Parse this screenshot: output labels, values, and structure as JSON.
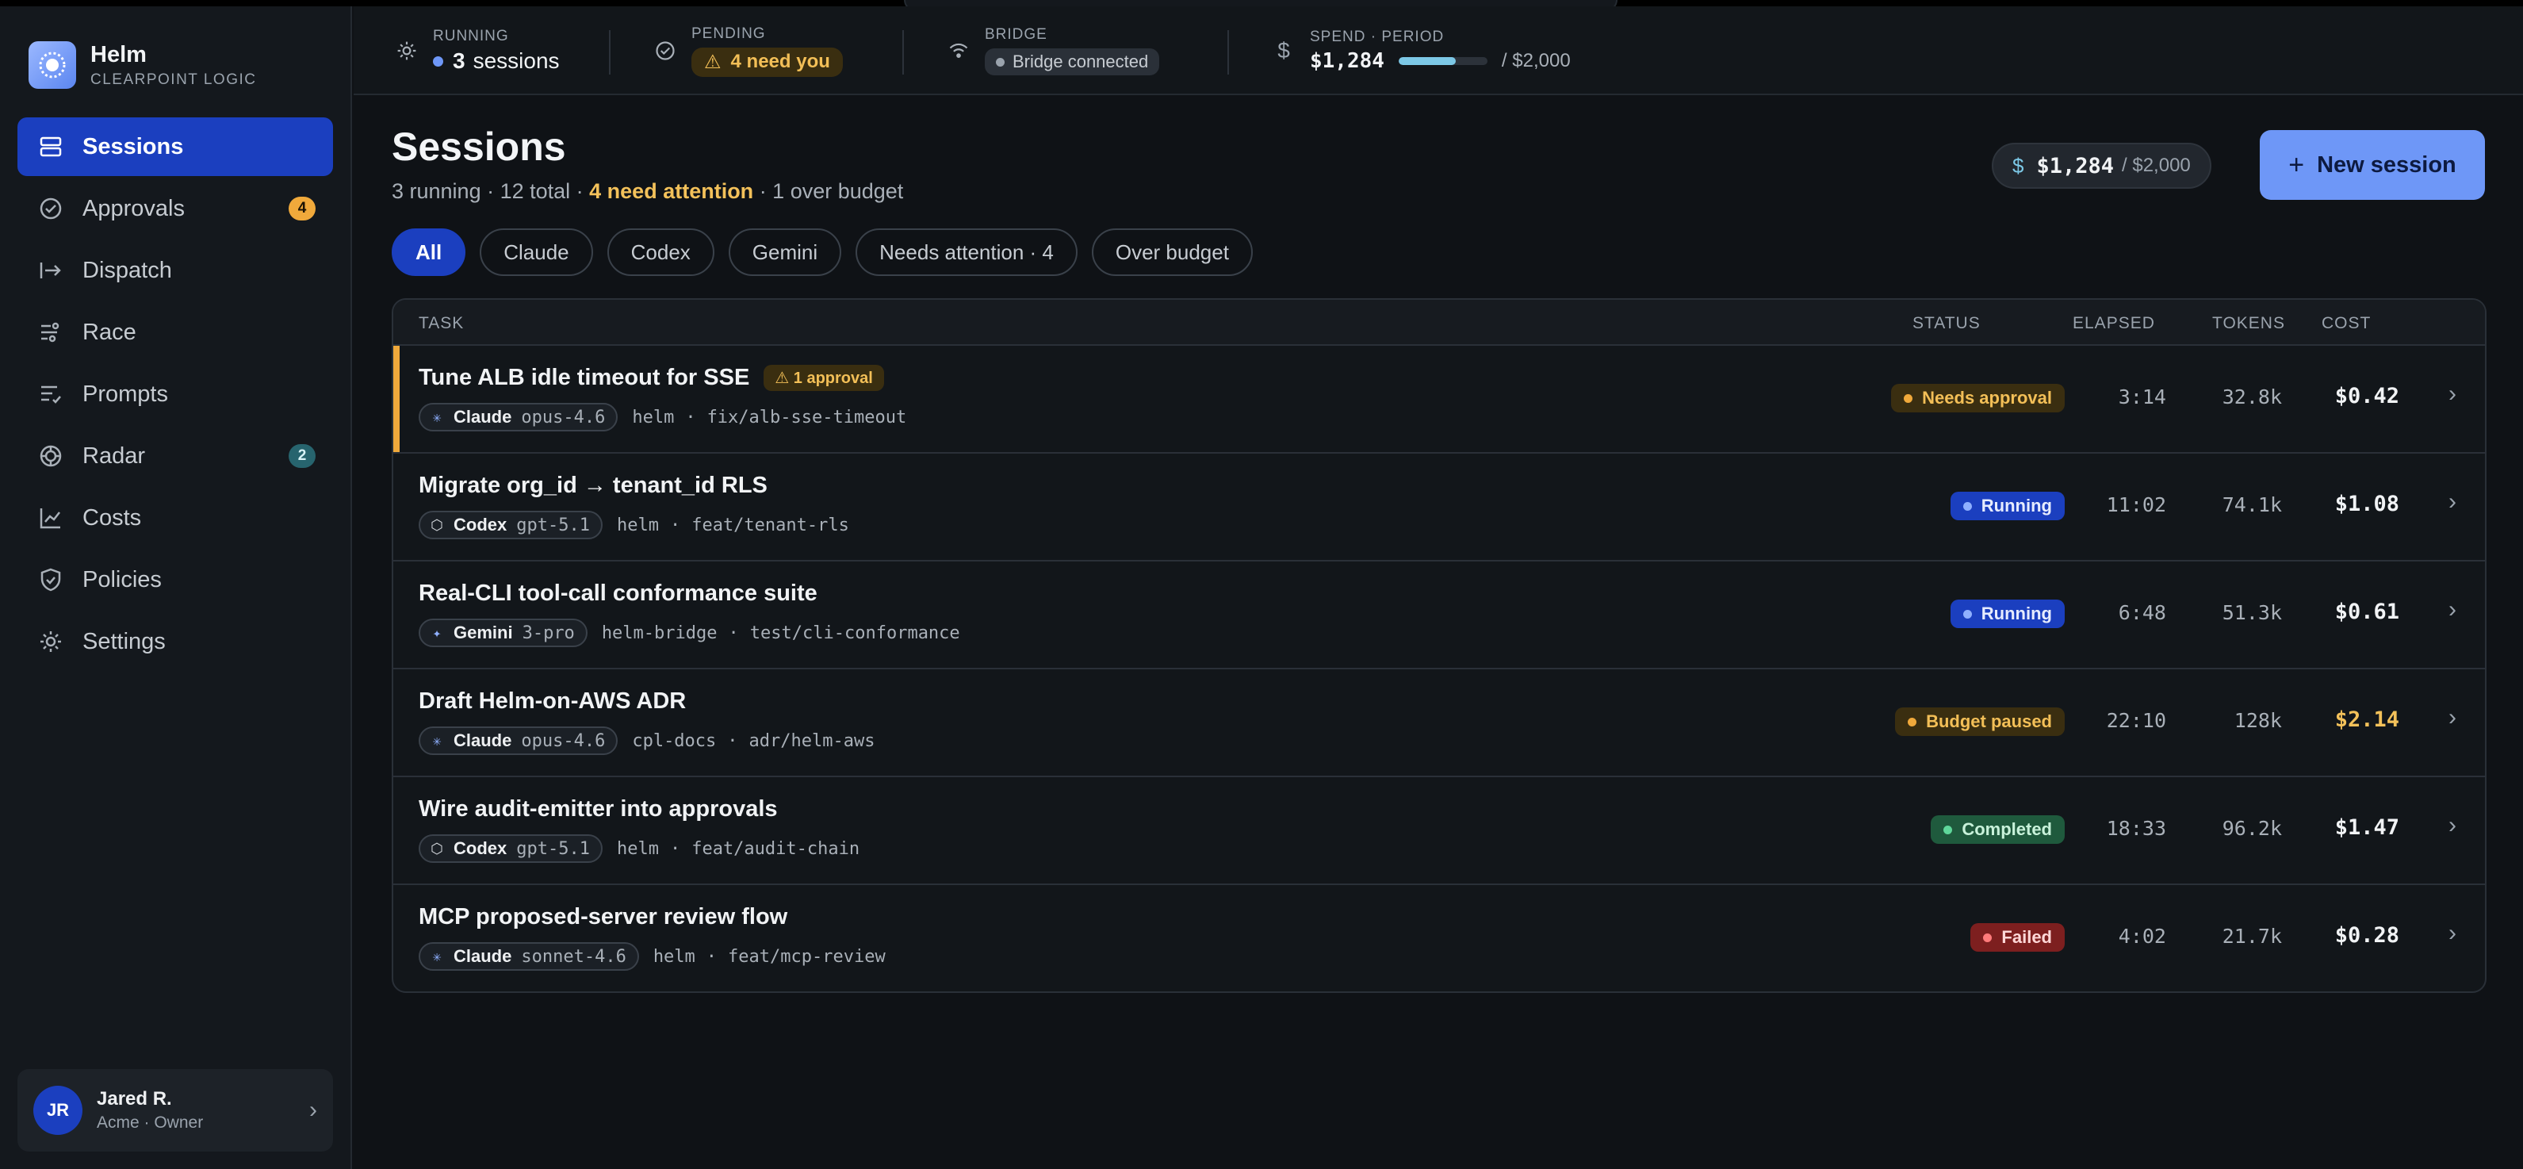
{
  "brand": {
    "name": "Helm",
    "subtitle": "CLEARPOINT LOGIC"
  },
  "sidebar": {
    "items": [
      {
        "label": "Sessions",
        "icon": "sessions-icon",
        "active": true
      },
      {
        "label": "Approvals",
        "icon": "approvals-icon",
        "badge": "4"
      },
      {
        "label": "Dispatch",
        "icon": "dispatch-icon"
      },
      {
        "label": "Race",
        "icon": "race-icon"
      },
      {
        "label": "Prompts",
        "icon": "prompts-icon"
      },
      {
        "label": "Radar",
        "icon": "radar-icon",
        "badge": "2"
      },
      {
        "label": "Costs",
        "icon": "costs-icon"
      },
      {
        "label": "Policies",
        "icon": "policies-icon"
      },
      {
        "label": "Settings",
        "icon": "settings-icon"
      }
    ]
  },
  "user": {
    "initials": "JR",
    "name": "Jared R.",
    "role": "Acme · Owner"
  },
  "statusbar": {
    "running": {
      "label": "RUNNING",
      "count": "3",
      "unit": "sessions"
    },
    "pending": {
      "label": "PENDING",
      "text": "4  need you"
    },
    "bridge": {
      "label": "BRIDGE",
      "text": "Bridge connected"
    },
    "spend": {
      "label": "SPEND · PERIOD",
      "amount": "$1,284",
      "limit": "/ $2,000",
      "fraction": 0.642
    }
  },
  "page": {
    "title": "Sessions",
    "subtitle_pre": "3 running · 12 total · ",
    "subtitle_highlight": "4 need attention",
    "subtitle_post": " · 1 over budget",
    "budget_amount": "$1,284",
    "budget_limit": "/ $2,000",
    "new_session_label": "New session"
  },
  "filters": [
    "All",
    "Claude",
    "Codex",
    "Gemini",
    "Needs attention · 4",
    "Over budget"
  ],
  "table": {
    "headers": {
      "task": "TASK",
      "status": "STATUS",
      "elapsed": "ELAPSED",
      "tokens": "TOKENS",
      "cost": "COST"
    },
    "rows": [
      {
        "title": "Tune ALB idle timeout for SSE",
        "approval": "⚠ 1 approval",
        "agent": "Claude",
        "model": "opus-4.6",
        "repo": "helm",
        "branch": "fix/alb-sse-timeout",
        "status": "Needs approval",
        "status_kind": "amber",
        "elapsed": "3:14",
        "tokens": "32.8k",
        "cost": "$0.42",
        "flag": true
      },
      {
        "title": "Migrate org_id → tenant_id RLS",
        "agent": "Codex",
        "model": "gpt-5.1",
        "repo": "helm",
        "branch": "feat/tenant-rls",
        "status": "Running",
        "status_kind": "blue",
        "elapsed": "11:02",
        "tokens": "74.1k",
        "cost": "$1.08"
      },
      {
        "title": "Real-CLI tool-call conformance suite",
        "agent": "Gemini",
        "model": "3-pro",
        "repo": "helm-bridge",
        "branch": "test/cli-conformance",
        "status": "Running",
        "status_kind": "blue",
        "elapsed": "6:48",
        "tokens": "51.3k",
        "cost": "$0.61"
      },
      {
        "title": "Draft Helm-on-AWS ADR",
        "agent": "Claude",
        "model": "opus-4.6",
        "repo": "cpl-docs",
        "branch": "adr/helm-aws",
        "status": "Budget paused",
        "status_kind": "amber",
        "elapsed": "22:10",
        "tokens": "128k",
        "cost": "$2.14",
        "cost_warn": true
      },
      {
        "title": "Wire audit-emitter into approvals",
        "agent": "Codex",
        "model": "gpt-5.1",
        "repo": "helm",
        "branch": "feat/audit-chain",
        "status": "Completed",
        "status_kind": "green",
        "elapsed": "18:33",
        "tokens": "96.2k",
        "cost": "$1.47"
      },
      {
        "title": "MCP proposed-server review flow",
        "agent": "Claude",
        "model": "sonnet-4.6",
        "repo": "helm",
        "branch": "feat/mcp-review",
        "status": "Failed",
        "status_kind": "red",
        "elapsed": "4:02",
        "tokens": "21.7k",
        "cost": "$0.28"
      }
    ]
  },
  "colors": {
    "accent": "#1b3fbf",
    "primary_button": "#6e97f7",
    "warning": "#f0a93b",
    "success": "#5fd79a",
    "danger": "#ff7b7b"
  }
}
